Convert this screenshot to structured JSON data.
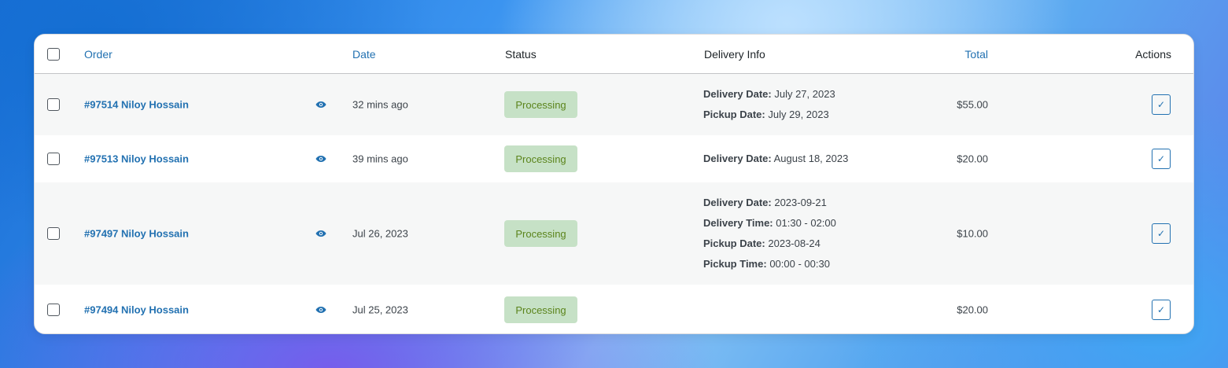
{
  "table": {
    "headers": {
      "order": "Order",
      "date": "Date",
      "status": "Status",
      "delivery_info": "Delivery Info",
      "total": "Total",
      "actions": "Actions"
    },
    "rows": [
      {
        "order": "#97514 Niloy Hossain",
        "date": "32 mins ago",
        "status": "Processing",
        "delivery": [
          {
            "label": "Delivery Date:",
            "value": "July 27, 2023"
          },
          {
            "label": "Pickup Date:",
            "value": "July 29, 2023"
          }
        ],
        "total": "$55.00"
      },
      {
        "order": "#97513 Niloy Hossain",
        "date": "39 mins ago",
        "status": "Processing",
        "delivery": [
          {
            "label": "Delivery Date:",
            "value": "August 18, 2023"
          }
        ],
        "total": "$20.00"
      },
      {
        "order": "#97497 Niloy Hossain",
        "date": "Jul 26, 2023",
        "status": "Processing",
        "delivery": [
          {
            "label": "Delivery Date:",
            "value": "2023-09-21"
          },
          {
            "label": "Delivery Time:",
            "value": "01:30 - 02:00"
          },
          {
            "label": "Pickup Date:",
            "value": "2023-08-24"
          },
          {
            "label": "Pickup Time:",
            "value": "00:00 - 00:30"
          }
        ],
        "total": "$10.00"
      },
      {
        "order": "#97494 Niloy Hossain",
        "date": "Jul 25, 2023",
        "status": "Processing",
        "delivery": [],
        "total": "$20.00"
      }
    ]
  },
  "icons": {
    "preview": "eye-icon",
    "complete": "checkmark-icon"
  },
  "colors": {
    "link": "#2271b1",
    "status_bg": "#c6e1c6",
    "status_text": "#5b841b"
  }
}
